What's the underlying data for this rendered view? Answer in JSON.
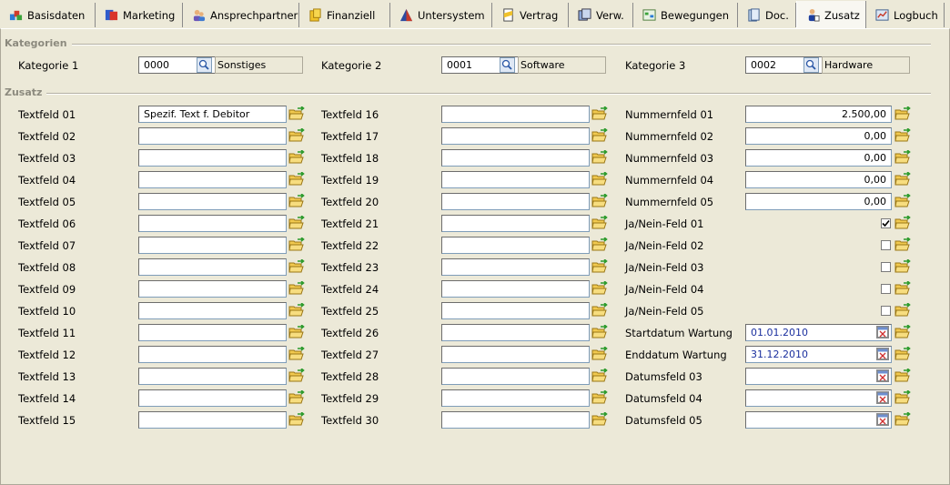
{
  "tabs": [
    {
      "label": "Basisdaten",
      "icon": "basisdaten-icon"
    },
    {
      "label": "Marketing",
      "icon": "marketing-icon"
    },
    {
      "label": "Ansprechpartner",
      "icon": "contacts-icon"
    },
    {
      "label": "Finanziell",
      "icon": "money-icon"
    },
    {
      "label": "Untersystem",
      "icon": "pyramid-icon"
    },
    {
      "label": "Vertrag",
      "icon": "contract-icon"
    },
    {
      "label": "Verw.",
      "icon": "admin-icon"
    },
    {
      "label": "Bewegungen",
      "icon": "movements-icon"
    },
    {
      "label": "Doc.",
      "icon": "documents-icon"
    },
    {
      "label": "Zusatz",
      "icon": "person-icon",
      "active": true
    },
    {
      "label": "Logbuch",
      "icon": "logbook-icon"
    }
  ],
  "sections": {
    "kategorien": "Kategorien",
    "zusatz": "Zusatz"
  },
  "kategorien": [
    {
      "label": "Kategorie 1",
      "code": "0000",
      "description": "Sonstiges"
    },
    {
      "label": "Kategorie 2",
      "code": "0001",
      "description": "Software"
    },
    {
      "label": "Kategorie 3",
      "code": "0002",
      "description": "Hardware"
    }
  ],
  "textfelder_col1": [
    {
      "label": "Textfeld 01",
      "value": "Spezif. Text f. Debitor"
    },
    {
      "label": "Textfeld 02",
      "value": ""
    },
    {
      "label": "Textfeld 03",
      "value": ""
    },
    {
      "label": "Textfeld 04",
      "value": ""
    },
    {
      "label": "Textfeld 05",
      "value": ""
    },
    {
      "label": "Textfeld 06",
      "value": ""
    },
    {
      "label": "Textfeld 07",
      "value": ""
    },
    {
      "label": "Textfeld 08",
      "value": ""
    },
    {
      "label": "Textfeld 09",
      "value": ""
    },
    {
      "label": "Textfeld 10",
      "value": ""
    },
    {
      "label": "Textfeld 11",
      "value": ""
    },
    {
      "label": "Textfeld 12",
      "value": ""
    },
    {
      "label": "Textfeld 13",
      "value": ""
    },
    {
      "label": "Textfeld 14",
      "value": ""
    },
    {
      "label": "Textfeld 15",
      "value": ""
    }
  ],
  "textfelder_col2": [
    {
      "label": "Textfeld 16",
      "value": ""
    },
    {
      "label": "Textfeld 17",
      "value": ""
    },
    {
      "label": "Textfeld 18",
      "value": ""
    },
    {
      "label": "Textfeld 19",
      "value": ""
    },
    {
      "label": "Textfeld 20",
      "value": ""
    },
    {
      "label": "Textfeld 21",
      "value": ""
    },
    {
      "label": "Textfeld 22",
      "value": ""
    },
    {
      "label": "Textfeld 23",
      "value": ""
    },
    {
      "label": "Textfeld 24",
      "value": ""
    },
    {
      "label": "Textfeld 25",
      "value": ""
    },
    {
      "label": "Textfeld 26",
      "value": ""
    },
    {
      "label": "Textfeld 27",
      "value": ""
    },
    {
      "label": "Textfeld 28",
      "value": ""
    },
    {
      "label": "Textfeld 29",
      "value": ""
    },
    {
      "label": "Textfeld 30",
      "value": ""
    }
  ],
  "nummernfelder": [
    {
      "label": "Nummernfeld 01",
      "value": "2.500,00"
    },
    {
      "label": "Nummernfeld 02",
      "value": "0,00"
    },
    {
      "label": "Nummernfeld 03",
      "value": "0,00"
    },
    {
      "label": "Nummernfeld 04",
      "value": "0,00"
    },
    {
      "label": "Nummernfeld 05",
      "value": "0,00"
    }
  ],
  "janeinfelder": [
    {
      "label": "Ja/Nein-Feld 01",
      "checked": true
    },
    {
      "label": "Ja/Nein-Feld 02",
      "checked": false
    },
    {
      "label": "Ja/Nein-Feld 03",
      "checked": false
    },
    {
      "label": "Ja/Nein-Feld 04",
      "checked": false
    },
    {
      "label": "Ja/Nein-Feld 05",
      "checked": false
    }
  ],
  "datumsfelder": [
    {
      "label": "Startdatum Wartung",
      "value": "01.01.2010"
    },
    {
      "label": "Enddatum Wartung",
      "value": "31.12.2010"
    },
    {
      "label": "Datumsfeld 03",
      "value": ""
    },
    {
      "label": "Datumsfeld 04",
      "value": ""
    },
    {
      "label": "Datumsfeld 05",
      "value": ""
    }
  ]
}
